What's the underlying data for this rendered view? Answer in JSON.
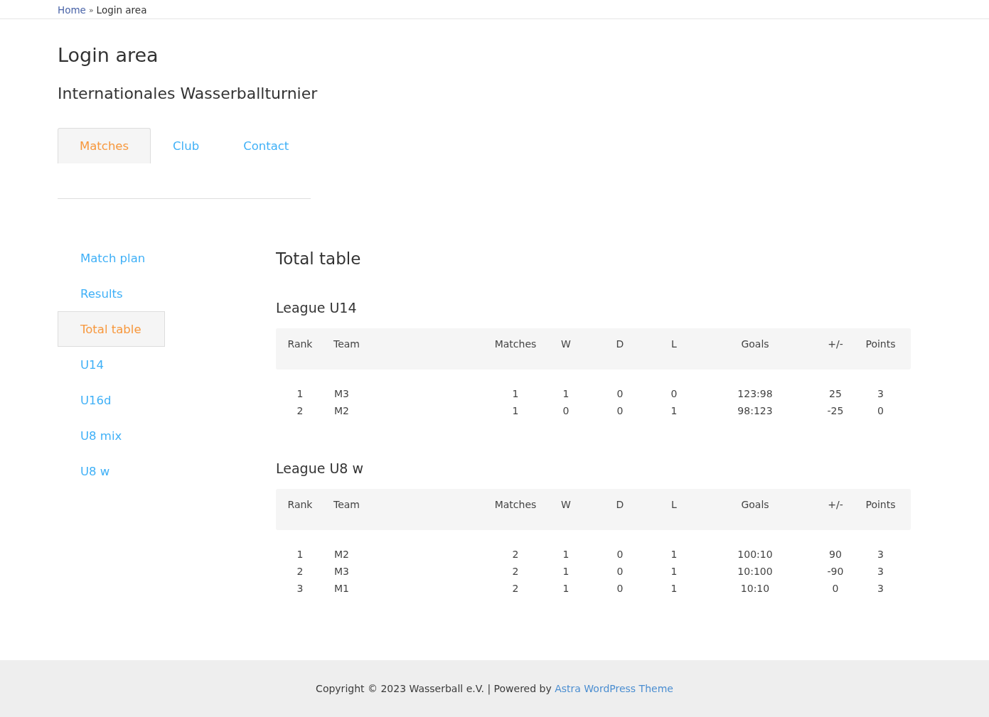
{
  "breadcrumb": {
    "link": "Home",
    "separator": "»",
    "current": "Login area"
  },
  "page_title": "Login area",
  "subtitle": "Internationales Wasserballturnier",
  "tabs": [
    {
      "label": "Matches",
      "selected": true
    },
    {
      "label": "Club",
      "selected": false
    },
    {
      "label": "Contact",
      "selected": false
    }
  ],
  "sidebar": {
    "items": [
      {
        "label": "Match plan",
        "selected": false
      },
      {
        "label": "Results",
        "selected": false
      },
      {
        "label": "Total table",
        "selected": true
      },
      {
        "label": "U14",
        "selected": false
      },
      {
        "label": "U16d",
        "selected": false
      },
      {
        "label": "U8 mix",
        "selected": false
      },
      {
        "label": "U8 w",
        "selected": false
      }
    ]
  },
  "content_title": "Total table",
  "leagues": [
    {
      "title": "League U14",
      "columns": [
        "Rank",
        "Team",
        "Matches",
        "W",
        "D",
        "L",
        "Goals",
        "+/-",
        "Points"
      ],
      "rows": [
        [
          "1",
          "M3",
          "1",
          "1",
          "0",
          "0",
          "123:98",
          "25",
          "3"
        ],
        [
          "2",
          "M2",
          "1",
          "0",
          "0",
          "1",
          "98:123",
          "-25",
          "0"
        ]
      ]
    },
    {
      "title": "League U8 w",
      "columns": [
        "Rank",
        "Team",
        "Matches",
        "W",
        "D",
        "L",
        "Goals",
        "+/-",
        "Points"
      ],
      "rows": [
        [
          "1",
          "M2",
          "2",
          "1",
          "0",
          "1",
          "100:10",
          "90",
          "3"
        ],
        [
          "2",
          "M3",
          "2",
          "1",
          "0",
          "1",
          "10:100",
          "-90",
          "3"
        ],
        [
          "3",
          "M1",
          "2",
          "1",
          "0",
          "1",
          "10:10",
          "0",
          "3"
        ]
      ]
    }
  ],
  "footer": {
    "text": "Copyright © 2023 Wasserball e.V. | Powered by",
    "link": "Astra WordPress Theme"
  }
}
